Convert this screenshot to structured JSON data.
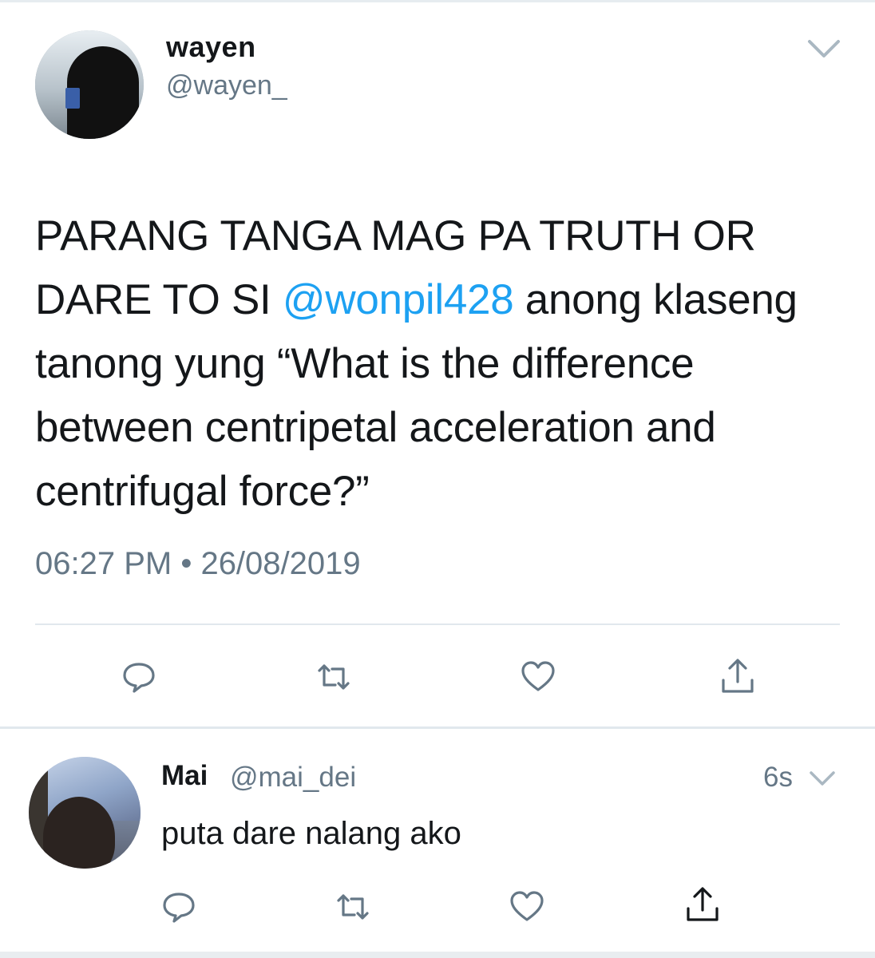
{
  "tweet": {
    "display_name": "wayen",
    "handle": "@wayen_",
    "text_before_mention": "PARANG TANGA MAG PA TRUTH OR DARE TO SI ",
    "mention": "@wonpil428",
    "text_after_mention": " anong klaseng tanong yung “What is the difference between centripetal acceleration and centrifugal force?”",
    "timestamp": "06:27 PM • 26/08/2019",
    "icons": {
      "more": "chevron-down-icon",
      "reply": "reply-icon",
      "retweet": "retweet-icon",
      "like": "heart-icon",
      "share": "share-icon"
    }
  },
  "reply": {
    "display_name": "Mai",
    "handle": "@mai_dei",
    "time": "6s",
    "text": "puta dare nalang ako"
  },
  "colors": {
    "link": "#1da1f2",
    "text": "#14171a",
    "secondary": "#657786",
    "divider": "#e1e8ed"
  }
}
